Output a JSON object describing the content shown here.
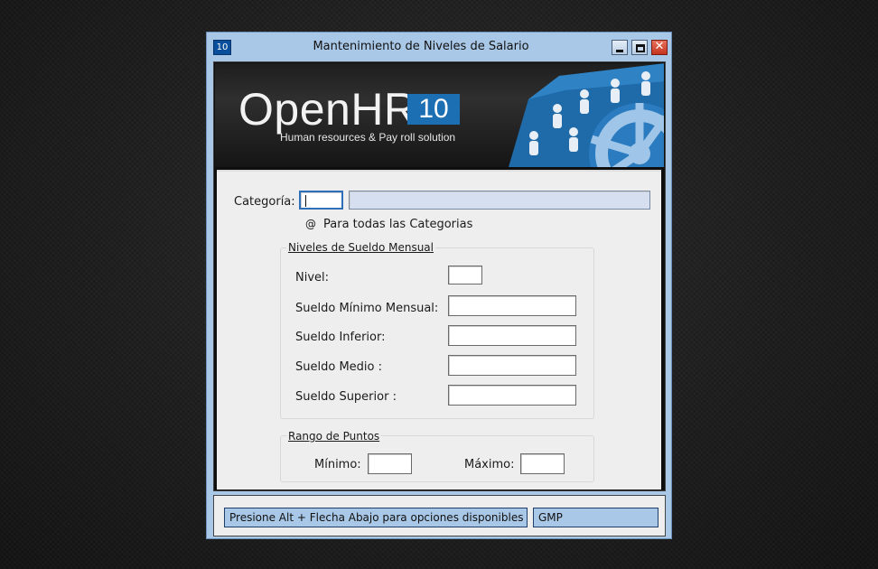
{
  "window": {
    "icon_text": "10",
    "title": "Mantenimiento de Niveles de Salario",
    "minimize_icon": "minimize-icon",
    "maximize_icon": "maximize-icon",
    "close_icon": "close-icon"
  },
  "banner": {
    "logo_text": "OpenHR",
    "logo_version": "10",
    "tagline": "Human resources & Pay roll solution",
    "accent_color": "#1d6fb3"
  },
  "form": {
    "categoria_label": "Categoría:",
    "categoria_value": "",
    "categoria_desc": "",
    "all_categories_marker": "@",
    "all_categories_label": "Para todas las Categorias",
    "niveles_group": {
      "title": "Niveles de Sueldo Mensual",
      "nivel_label": "Nivel:",
      "sueldo_minimo_label": "Sueldo Mínimo Mensual:",
      "sueldo_inferior_label": "Sueldo Inferior:",
      "sueldo_medio_label": "Sueldo Medio :",
      "sueldo_superior_label": "Sueldo Superior :",
      "nivel_value": "",
      "sueldo_minimo_value": "",
      "sueldo_inferior_value": "",
      "sueldo_medio_value": "",
      "sueldo_superior_value": ""
    },
    "rango_group": {
      "title": "Rango de Puntos",
      "minimo_label": "Mínimo:",
      "maximo_label": "Máximo:",
      "minimo_value": "",
      "maximo_value": ""
    }
  },
  "status": {
    "message": "Presione Alt + Flecha Abajo para  opciones disponibles ó <Ent",
    "user": "GMP"
  }
}
